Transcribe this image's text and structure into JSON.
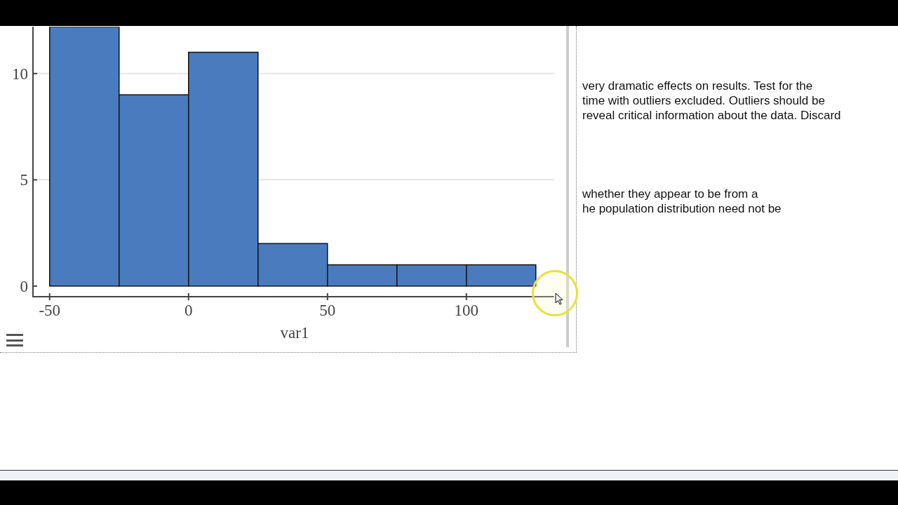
{
  "chart_panel": {
    "chart_data": {
      "type": "bar",
      "xlabel": "var1",
      "x": [
        -37.5,
        -12.5,
        12.5,
        37.5,
        62.5,
        87.5,
        112.5
      ],
      "series": [
        {
          "color": "#4a7bbf",
          "values": [
            12.2,
            9,
            11,
            2,
            1,
            1,
            1
          ]
        }
      ],
      "xlim": [
        -56,
        131.5
      ],
      "ylim": [
        -0.5,
        12.2
      ],
      "xticks": [
        {
          "value": -50,
          "label": "-50"
        },
        {
          "value": 0,
          "label": "0"
        },
        {
          "value": 50,
          "label": "50"
        },
        {
          "value": 100,
          "label": "100"
        }
      ],
      "yticks": [
        {
          "value": 0,
          "label": "0"
        },
        {
          "value": 5,
          "label": "5"
        },
        {
          "value": 10,
          "label": "10"
        }
      ]
    }
  },
  "paragraphs": [
    {
      "lines": [
        "very dramatic effects on results. Test for the",
        "time with outliers excluded. Outliers should be",
        "reveal critical information about the data. Discard"
      ]
    },
    {
      "lines": [
        "whether they appear to be from a",
        "he population distribution need not be"
      ]
    }
  ]
}
